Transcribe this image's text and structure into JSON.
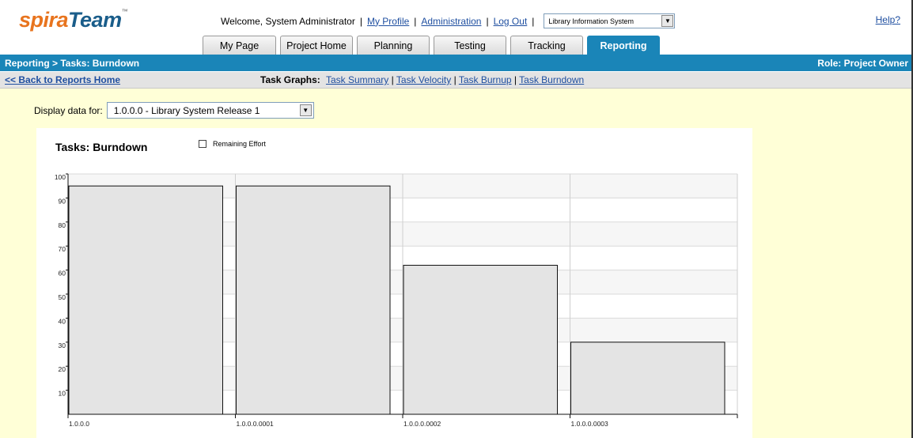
{
  "app": {
    "logo_part1": "spira",
    "logo_part2": "Team",
    "logo_tm": "™"
  },
  "header": {
    "welcome": "Welcome, System Administrator",
    "separator": "|",
    "my_profile": "My Profile",
    "administration": "Administration",
    "log_out": "Log Out",
    "project": "Library Information System",
    "help": "Help?"
  },
  "tabs": [
    {
      "label": "My Page",
      "active": false
    },
    {
      "label": "Project Home",
      "active": false
    },
    {
      "label": "Planning",
      "active": false
    },
    {
      "label": "Testing",
      "active": false
    },
    {
      "label": "Tracking",
      "active": false
    },
    {
      "label": "Reporting",
      "active": true
    }
  ],
  "breadcrumb": "Reporting > Tasks: Burndown",
  "role": "Role: Project Owner",
  "subnav": {
    "back": "<< Back to Reports Home",
    "task_graphs_label": "Task Graphs:",
    "links": [
      "Task Summary",
      "Task Velocity",
      "Task Burnup",
      "Task Burndown"
    ],
    "link_separator": "|"
  },
  "filter": {
    "label": "Display data for:",
    "value": "1.0.0.0 - Library System Release 1"
  },
  "chart_title": "Tasks: Burndown",
  "legend_label": "Remaining Effort",
  "colors": {
    "accent": "#1a85b8",
    "content_bg": "#ffffd7",
    "bar_fill": "#e4e4e4",
    "logo_orange": "#e8741e",
    "logo_blue": "#1a5d8a"
  },
  "chart_data": {
    "type": "bar",
    "categories": [
      "1.0.0.0",
      "1.0.0.0.0001",
      "1.0.0.0.0002",
      "1.0.0.0.0003"
    ],
    "series": [
      {
        "values": [
          95,
          95,
          62,
          30
        ]
      }
    ],
    "ylim": [
      0,
      100
    ],
    "yticks": [
      10,
      20,
      30,
      40,
      50,
      60,
      70,
      80,
      90,
      100
    ],
    "grid": true,
    "legend": "top"
  }
}
